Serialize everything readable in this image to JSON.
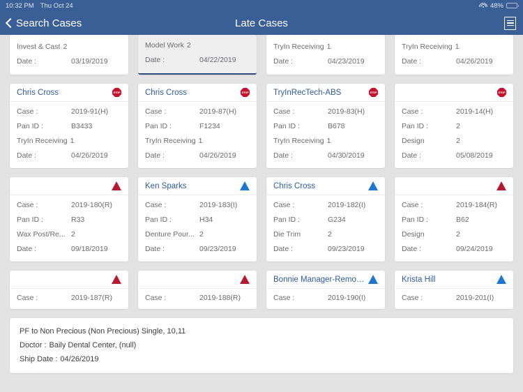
{
  "status_bar": {
    "time": "10:32 PM",
    "date": "Thu Oct 24",
    "battery_percent": "48%",
    "wifi_icon": "wifi-icon",
    "battery_icon": "battery-icon"
  },
  "nav": {
    "back_label": "Search Cases",
    "back_icon": "chevron-left-icon",
    "title": "Late Cases",
    "menu_icon": "list-view-icon"
  },
  "theme": {
    "header_blue": "#3a5f96",
    "title_blue": "#2f5b9c",
    "page_bg": "#e3e3e3",
    "card_bg": "#ffffff",
    "selected_bg": "#efefef",
    "stop_red": "#c7102e",
    "triangle_red": "#b51832",
    "triangle_blue": "#1d76d2"
  },
  "labels": {
    "case": "Case :",
    "pan_id": "Pan ID :",
    "date": "Date :"
  },
  "rows": [
    {
      "partial": true,
      "cards": [
        {
          "title": "",
          "icon": "",
          "fields": [
            {
              "label": "Invest & Cast",
              "value": "2",
              "tight": true
            },
            {
              "label": "Date :",
              "value": "03/19/2019"
            }
          ],
          "selected": false
        },
        {
          "title": "",
          "icon": "",
          "fields": [
            {
              "label": "Model Work",
              "value": "2",
              "tight": true
            },
            {
              "label": "Date :",
              "value": "04/22/2019"
            }
          ],
          "selected": true
        },
        {
          "title": "",
          "icon": "",
          "fields": [
            {
              "label": "TryIn Receiving",
              "value": "1",
              "tight": true
            },
            {
              "label": "Date :",
              "value": "04/23/2019"
            }
          ],
          "selected": false
        },
        {
          "title": "",
          "icon": "",
          "fields": [
            {
              "label": "TryIn Receiving",
              "value": "1",
              "tight": true
            },
            {
              "label": "Date :",
              "value": "04/26/2019"
            }
          ],
          "selected": false
        }
      ]
    },
    {
      "partial": false,
      "cards": [
        {
          "title": "Chris Cross",
          "icon": "stop",
          "fields": [
            {
              "label": "Case :",
              "value": "2019-91(H)"
            },
            {
              "label": "Pan ID :",
              "value": "B3433"
            },
            {
              "label": "TryIn Receiving",
              "value": "1",
              "tight": true
            },
            {
              "label": "Date :",
              "value": "04/26/2019"
            }
          ],
          "selected": false
        },
        {
          "title": "Chris Cross",
          "icon": "stop",
          "fields": [
            {
              "label": "Case :",
              "value": "2019-87(H)"
            },
            {
              "label": "Pan ID :",
              "value": "F1234"
            },
            {
              "label": "TryIn Receiving",
              "value": "1",
              "tight": true
            },
            {
              "label": "Date :",
              "value": "04/26/2019"
            }
          ],
          "selected": false
        },
        {
          "title": "TryInRecTech-ABS",
          "icon": "stop",
          "fields": [
            {
              "label": "Case :",
              "value": "2019-83(H)"
            },
            {
              "label": "Pan ID :",
              "value": "B678"
            },
            {
              "label": "TryIn Receiving",
              "value": "1",
              "tight": true
            },
            {
              "label": "Date :",
              "value": "04/30/2019"
            }
          ],
          "selected": false
        },
        {
          "title": "",
          "icon": "stop",
          "fields": [
            {
              "label": "Case :",
              "value": "2019-14(H)"
            },
            {
              "label": "Pan ID :",
              "value": "2"
            },
            {
              "label": "Design",
              "value": "2"
            },
            {
              "label": "Date :",
              "value": "05/08/2019"
            }
          ],
          "selected": false
        }
      ]
    },
    {
      "partial": false,
      "cards": [
        {
          "title": "",
          "icon": "triangle-red",
          "fields": [
            {
              "label": "Case :",
              "value": "2019-180(R)"
            },
            {
              "label": "Pan ID :",
              "value": "R33"
            },
            {
              "label": "Wax Post/Re...",
              "value": "2"
            },
            {
              "label": "Date :",
              "value": "09/18/2019"
            }
          ],
          "selected": false
        },
        {
          "title": "Ken Sparks",
          "icon": "triangle-blue",
          "fields": [
            {
              "label": "Case :",
              "value": "2019-183(I)"
            },
            {
              "label": "Pan ID :",
              "value": "H34"
            },
            {
              "label": "Denture Pour...",
              "value": "2"
            },
            {
              "label": "Date :",
              "value": "09/23/2019"
            }
          ],
          "selected": false
        },
        {
          "title": "Chris Cross",
          "icon": "triangle-blue",
          "fields": [
            {
              "label": "Case :",
              "value": "2019-182(I)"
            },
            {
              "label": "Pan ID :",
              "value": "G234"
            },
            {
              "label": "Die Trim",
              "value": "2"
            },
            {
              "label": "Date :",
              "value": "09/23/2019"
            }
          ],
          "selected": false
        },
        {
          "title": "",
          "icon": "triangle-red",
          "fields": [
            {
              "label": "Case :",
              "value": "2019-184(R)"
            },
            {
              "label": "Pan ID :",
              "value": "B62"
            },
            {
              "label": "Design",
              "value": "2"
            },
            {
              "label": "Date :",
              "value": "09/24/2019"
            }
          ],
          "selected": false
        }
      ]
    },
    {
      "partial": false,
      "short": true,
      "cards": [
        {
          "title": "",
          "icon": "triangle-red",
          "fields": [
            {
              "label": "Case :",
              "value": "2019-187(R)"
            }
          ],
          "selected": false
        },
        {
          "title": "",
          "icon": "triangle-red",
          "fields": [
            {
              "label": "Case :",
              "value": "2019-188(R)"
            }
          ],
          "selected": false
        },
        {
          "title": "Bonnie Manager-Remova...",
          "icon": "triangle-blue",
          "fields": [
            {
              "label": "Case :",
              "value": "2019-190(I)"
            }
          ],
          "selected": false
        },
        {
          "title": "Krista Hill",
          "icon": "triangle-blue",
          "fields": [
            {
              "label": "Case :",
              "value": "2019-201(I)"
            }
          ],
          "selected": false
        }
      ]
    }
  ],
  "detail_panel": {
    "description": "PF to Non Precious (Non Precious) Single, 10,11",
    "doctor_label": "Doctor :",
    "doctor_value": "Baily Dental Center, (null)",
    "ship_date_label": "Ship Date :",
    "ship_date_value": "04/26/2019"
  }
}
